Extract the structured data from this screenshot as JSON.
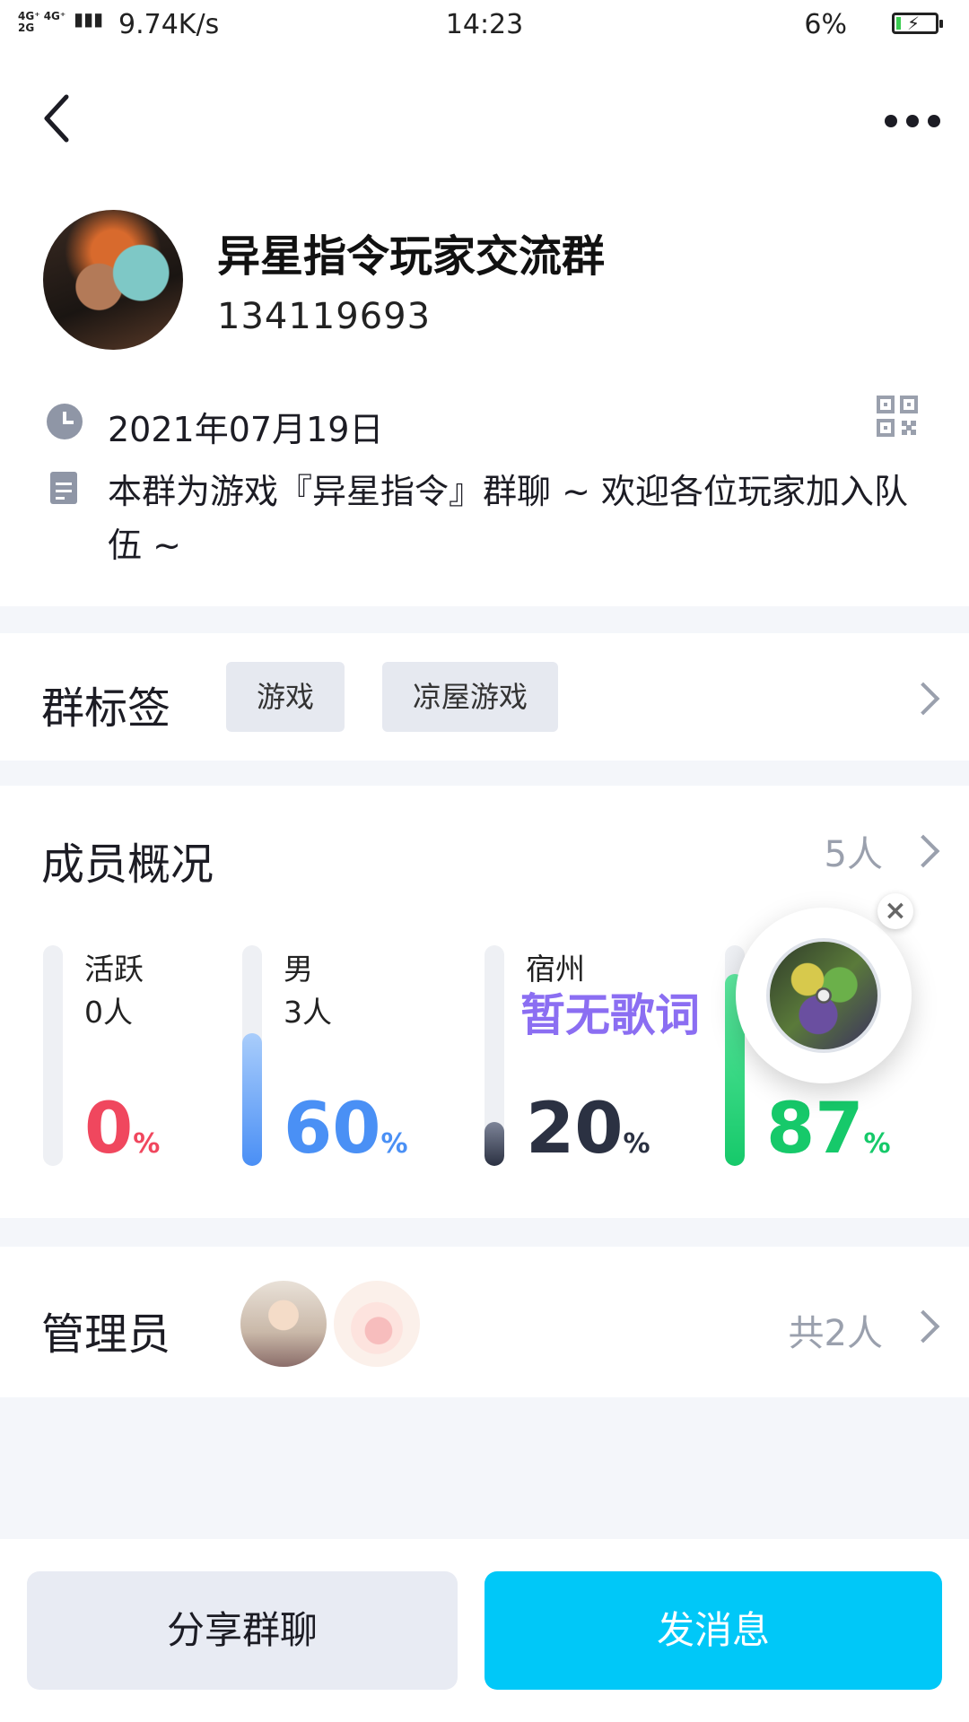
{
  "status_bar": {
    "network": "4G⁺ 4G⁺\n2G",
    "speed": "9.74K/s",
    "time": "14:23",
    "battery": "6%"
  },
  "group": {
    "name": "异星指令玩家交流群",
    "id": "134119693",
    "created_date": "2021年07月19日",
    "description": "本群为游戏『异星指令』群聊 ~ 欢迎各位玩家加入队伍 ~"
  },
  "tags_section": {
    "title": "群标签",
    "tags": [
      "游戏",
      "凉屋游戏"
    ]
  },
  "members_section": {
    "title": "成员概况",
    "count": "5人",
    "stats": [
      {
        "label": "活跃",
        "sub": "0人",
        "percent": "0",
        "unit": "%",
        "fill": 0,
        "color": "#f0475e"
      },
      {
        "label": "男",
        "sub": "3人",
        "percent": "60",
        "unit": "%",
        "fill": 0.6,
        "color": "#4a90f5"
      },
      {
        "label": "宿州",
        "sub": "",
        "percent": "20",
        "unit": "%",
        "fill": 0.2,
        "color": "#2b3142"
      },
      {
        "label": "",
        "sub": "",
        "percent": "87",
        "unit": "%",
        "fill": 0.87,
        "color": "#16c96a"
      }
    ],
    "lyrics_overlay": "暂无歌词"
  },
  "admins_section": {
    "title": "管理员",
    "count": "共2人"
  },
  "actions": {
    "share": "分享群聊",
    "send": "发消息"
  },
  "colors": {
    "accent": "#00c8f8",
    "page_bg": "#f4f6fa"
  }
}
